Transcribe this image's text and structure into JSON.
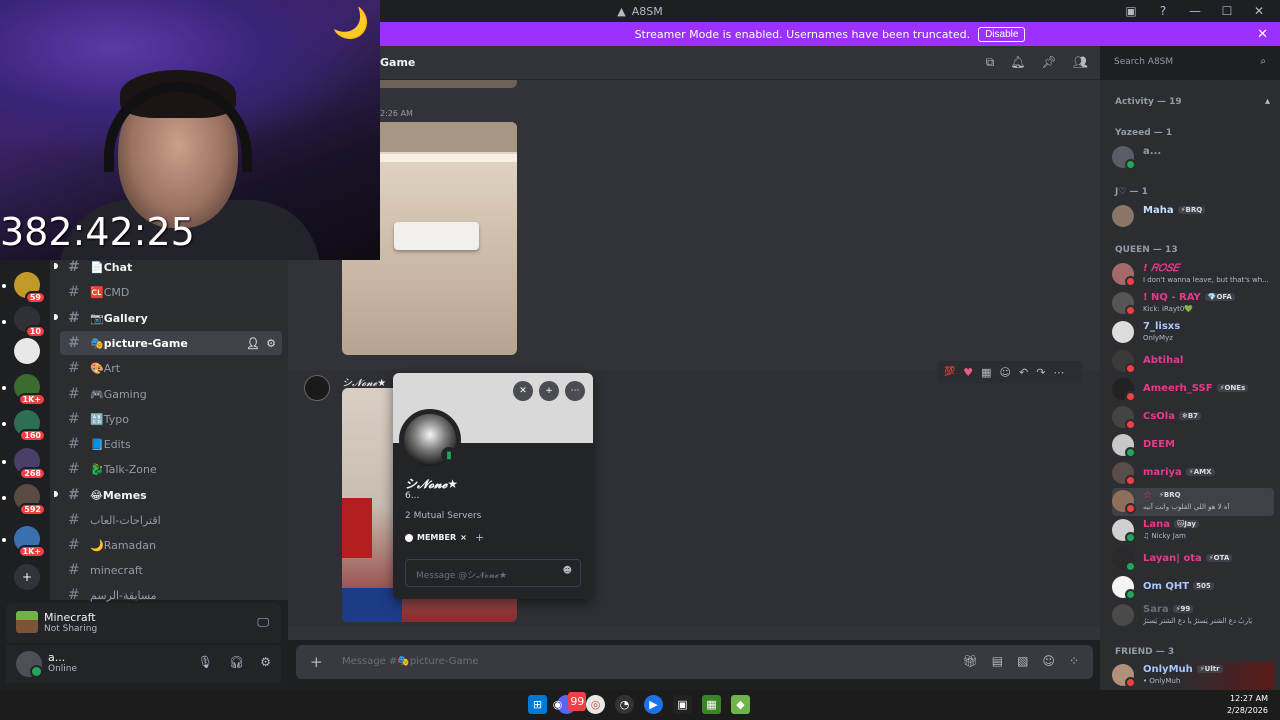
{
  "window": {
    "title": "A8SM",
    "controls": [
      "▣",
      "?",
      "—",
      "☐",
      "✕"
    ]
  },
  "banner": {
    "text": "Streamer Mode is enabled. Usernames have been truncated.",
    "disable_label": "Disable",
    "close": "✕"
  },
  "webcam": {
    "timer": "382:42:25",
    "moon": "🌙"
  },
  "servers": [
    {
      "badge": "59"
    },
    {
      "badge": "10"
    },
    {
      "badge": ""
    },
    {
      "badge": "1K+"
    },
    {
      "badge": "160"
    },
    {
      "badge": "268"
    },
    {
      "badge": "592"
    },
    {
      "badge": "1K+"
    }
  ],
  "add_server": "+",
  "channels": [
    {
      "name": "📄Chat",
      "bold": true
    },
    {
      "name": "🆑CMD",
      "bold": false
    },
    {
      "name": "📷Gallery",
      "bold": true
    },
    {
      "name": "🎭picture-Game",
      "active": true
    },
    {
      "name": "🎨Art",
      "bold": false
    },
    {
      "name": "🎮Gaming",
      "bold": false
    },
    {
      "name": "🔠Typo",
      "bold": false
    },
    {
      "name": "📘Edits",
      "bold": false
    },
    {
      "name": "🐉Talk-Zone",
      "bold": false
    },
    {
      "name": "😂Memes",
      "bold": true
    },
    {
      "name": "اقتراحات-العاب",
      "bold": false
    },
    {
      "name": "🌙Ramadan",
      "bold": false
    },
    {
      "name": "minecraft",
      "bold": false
    },
    {
      "name": "مسابقة-الرسم",
      "bold": false
    }
  ],
  "activity": {
    "game": "Minecraft",
    "status": "Not Sharing"
  },
  "user": {
    "name": "a...",
    "status": "Online"
  },
  "header": {
    "channel_title": "Game"
  },
  "search": {
    "placeholder": "Search A8SM"
  },
  "messages": {
    "timestamp": "2:26 AM",
    "author2": "シ𝓝𝓸𝓷𝓮★"
  },
  "reactions": {
    "hundred": "💯",
    "heart": "♥"
  },
  "popout": {
    "display_name": "シ𝓝𝓸𝓷𝓮★",
    "username": "6...",
    "mutual_servers": "2 Mutual Servers",
    "role": "MEMBER",
    "message_placeholder": "Message @シ𝓝𝓸𝓷𝓮★"
  },
  "composer": {
    "placeholder": "Message #🎭picture-Game"
  },
  "member_list": {
    "activity_header": "Activity — 19",
    "groups": [
      {
        "title": "Yazeed — 1",
        "members": [
          {
            "name": "a...",
            "color": "#949ba4",
            "sub": "",
            "tag": ""
          }
        ]
      },
      {
        "title": "J♡ — 1",
        "members": [
          {
            "name": "Maha",
            "color": "#c9e0ff",
            "sub": "",
            "tag": "⚡BRQ"
          }
        ]
      },
      {
        "title": "QUEEN — 13",
        "members": [
          {
            "name": "! 𝑅𝑂𝑆𝐸",
            "color": "#e63a8b",
            "sub": "I don't wanna leave, but that's wh...",
            "tag": ""
          },
          {
            "name": "! NQ - RAY",
            "color": "#e63a8b",
            "sub": "Kick: iRayt0💚",
            "tag": "💎OFA"
          },
          {
            "name": "7_lisxs",
            "color": "#a9c7ff",
            "sub": "OnlyMyz",
            "tag": ""
          },
          {
            "name": "Abtihal",
            "color": "#e63a8b",
            "sub": "",
            "tag": ""
          },
          {
            "name": "Ameerh_SSF",
            "color": "#e63a8b",
            "sub": "",
            "tag": "⚡ONEs"
          },
          {
            "name": "CsOla",
            "color": "#e63a8b",
            "sub": "",
            "tag": "❄B7"
          },
          {
            "name": "DEEM",
            "color": "#e63a8b",
            "sub": "",
            "tag": ""
          },
          {
            "name": "mariya",
            "color": "#e63a8b",
            "sub": "",
            "tag": "⚡AMX"
          },
          {
            "name": "☆",
            "color": "#e63a8b",
            "sub": "ﺁﻩ ﻻ ﻫﻮ اللي القلوب وأنت آنيه",
            "tag": "⚡BRQ"
          },
          {
            "name": "Lana",
            "color": "#e63a8b",
            "sub": "♫ Nicky Jam",
            "tag": "🐱Jay"
          },
          {
            "name": "Layan| ota",
            "color": "#e63a8b",
            "sub": "",
            "tag": "⚡OTA"
          },
          {
            "name": "Om QHT",
            "color": "#a9c7ff",
            "sub": "",
            "tag": "505"
          },
          {
            "name": "Sara",
            "color": "#6d6f78",
            "sub": "يَاربُ دع الشتر يَسترُ يا دع الشتر يَسترُ",
            "tag": "⚡99"
          }
        ]
      },
      {
        "title": "FRIEND — 3",
        "members": [
          {
            "name": "OnlyMuh",
            "color": "#a9c7ff",
            "sub": "• OnlyMuh",
            "tag": "⚡Ultr"
          }
        ]
      }
    ]
  },
  "taskbar": {
    "discord_badge": "99",
    "time": "12:27 AM",
    "date": "2/28/2026"
  }
}
